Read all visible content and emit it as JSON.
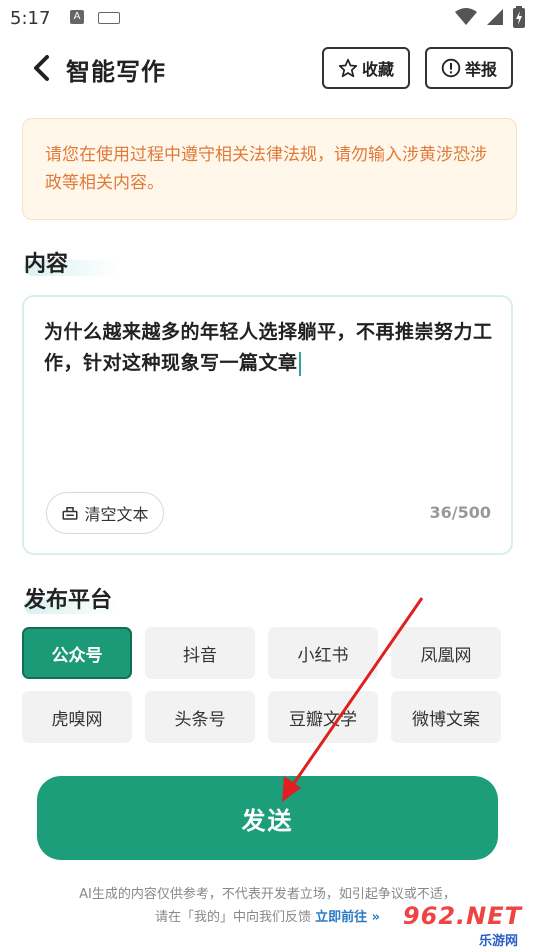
{
  "status_bar": {
    "time": "5:17",
    "a_icon_letter": "A"
  },
  "header": {
    "title": "智能写作",
    "favorite_label": "收藏",
    "report_label": "举报"
  },
  "notice": {
    "text": "请您在使用过程中遵守相关法律法规，请勿输入涉黄涉恐涉政等相关内容。"
  },
  "content_section": {
    "title": "内容",
    "text": "为什么越来越多的年轻人选择躺平，不再推崇努力工作，针对这种现象写一篇文章",
    "clear_label": "清空文本",
    "char_count": "36/500"
  },
  "platform_section": {
    "title": "发布平台",
    "platforms": [
      {
        "label": "公众号",
        "selected": true
      },
      {
        "label": "抖音",
        "selected": false
      },
      {
        "label": "小红书",
        "selected": false
      },
      {
        "label": "凤凰网",
        "selected": false
      },
      {
        "label": "虎嗅网",
        "selected": false
      },
      {
        "label": "头条号",
        "selected": false
      },
      {
        "label": "豆瓣文学",
        "selected": false
      },
      {
        "label": "微博文案",
        "selected": false
      }
    ]
  },
  "send_button": {
    "label": "发送"
  },
  "footer": {
    "line1": "AI生成的内容仅供参考，不代表开发者立场，如引起争议或不适，",
    "line2_prefix": "请在「我的」中向我们反馈",
    "link_label": "立即前往",
    "link_arrow": "»"
  },
  "watermark": {
    "top": "962.NET",
    "bottom": "乐游网"
  },
  "colors": {
    "accent": "#1c9e7b",
    "notice_text": "#e07a3a",
    "notice_bg": "#fff7ea",
    "link": "#2a7ac4",
    "arrow": "#e02020"
  },
  "icons": {
    "back": "chevron-left-icon",
    "favorite": "star-icon",
    "report": "exclamation-circle-icon",
    "clear": "eraser-icon"
  }
}
